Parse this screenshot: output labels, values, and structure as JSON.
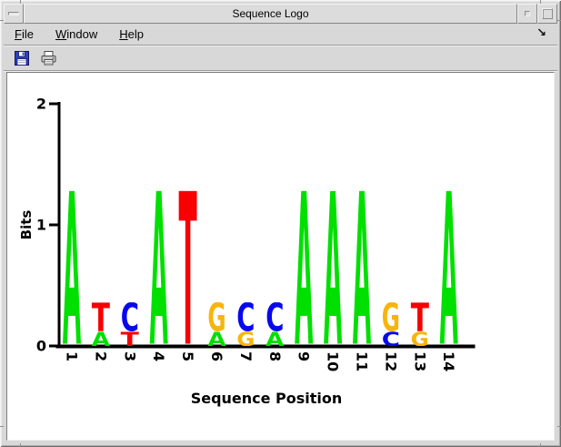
{
  "window": {
    "title": "Sequence Logo"
  },
  "titlebar": {
    "menu_button_icon": "window-menu-dash-icon",
    "minimize_icon": "minimize-square-icon",
    "maximize_icon": "maximize-square-icon"
  },
  "menubar": {
    "items": [
      {
        "label": "File",
        "head": "F",
        "tail": "ile"
      },
      {
        "label": "Window",
        "head": "W",
        "tail": "indow"
      },
      {
        "label": "Help",
        "head": "H",
        "tail": "elp"
      }
    ],
    "corner_arrow_glyph": "↘"
  },
  "toolbar": {
    "buttons": [
      {
        "name": "save",
        "icon": "floppy-disk-icon"
      },
      {
        "name": "print",
        "icon": "printer-icon"
      }
    ]
  },
  "chart_data": {
    "type": "bar",
    "subtype": "sequence_logo",
    "title": "",
    "xlabel": "Sequence Position",
    "ylabel": "Bits",
    "ylim": [
      0,
      2
    ],
    "yticks": [
      0,
      1,
      2
    ],
    "legend": "none",
    "grid": false,
    "base_colors": {
      "A": "#00E000",
      "C": "#0808EE",
      "G": "#F7B50C",
      "T": "#F80000"
    },
    "stacks": [
      {
        "position": "1",
        "letters": [
          {
            "base": "A",
            "bits": 1.28
          }
        ]
      },
      {
        "position": "2",
        "letters": [
          {
            "base": "A",
            "bits": 0.12
          },
          {
            "base": "T",
            "bits": 0.24
          }
        ]
      },
      {
        "position": "3",
        "letters": [
          {
            "base": "T",
            "bits": 0.12
          },
          {
            "base": "C",
            "bits": 0.24
          }
        ]
      },
      {
        "position": "4",
        "letters": [
          {
            "base": "A",
            "bits": 1.28
          }
        ]
      },
      {
        "position": "5",
        "letters": [
          {
            "base": "T",
            "bits": 1.28
          }
        ]
      },
      {
        "position": "6",
        "letters": [
          {
            "base": "A",
            "bits": 0.12
          },
          {
            "base": "G",
            "bits": 0.24
          }
        ]
      },
      {
        "position": "7",
        "letters": [
          {
            "base": "G",
            "bits": 0.12
          },
          {
            "base": "C",
            "bits": 0.24
          }
        ]
      },
      {
        "position": "8",
        "letters": [
          {
            "base": "A",
            "bits": 0.12
          },
          {
            "base": "C",
            "bits": 0.24
          }
        ]
      },
      {
        "position": "9",
        "letters": [
          {
            "base": "A",
            "bits": 1.28
          }
        ]
      },
      {
        "position": "10",
        "letters": [
          {
            "base": "A",
            "bits": 1.28
          }
        ]
      },
      {
        "position": "11",
        "letters": [
          {
            "base": "A",
            "bits": 1.28
          }
        ]
      },
      {
        "position": "12",
        "letters": [
          {
            "base": "C",
            "bits": 0.12
          },
          {
            "base": "G",
            "bits": 0.24
          }
        ]
      },
      {
        "position": "13",
        "letters": [
          {
            "base": "G",
            "bits": 0.12
          },
          {
            "base": "T",
            "bits": 0.24
          }
        ]
      },
      {
        "position": "14",
        "letters": [
          {
            "base": "A",
            "bits": 1.28
          }
        ]
      }
    ]
  }
}
